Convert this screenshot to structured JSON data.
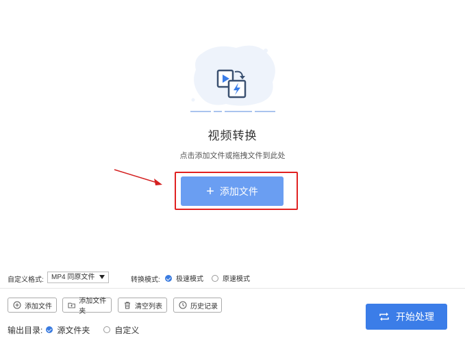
{
  "hero": {
    "title": "视频转换",
    "hint": "点击添加文件或拖拽文件到此处",
    "add_button_label": "添加文件",
    "icon": "video-convert-icon"
  },
  "settings": {
    "format_label": "自定义格式:",
    "format_value": "MP4 同原文件",
    "mode_label": "转换模式:",
    "mode_options": [
      "极速模式",
      "原速模式"
    ],
    "mode_selected": "极速模式"
  },
  "toolbar": {
    "add_file": "添加文件",
    "add_folder": "添加文件夹",
    "clear_list": "清空列表",
    "history": "历史记录"
  },
  "output": {
    "label": "输出目录:",
    "options": [
      "源文件夹",
      "自定义"
    ],
    "selected": "源文件夹"
  },
  "start_button": "开始处理",
  "colors": {
    "accent": "#3b7de8",
    "add_button": "#6a9ef2",
    "highlight": "#e02020"
  }
}
